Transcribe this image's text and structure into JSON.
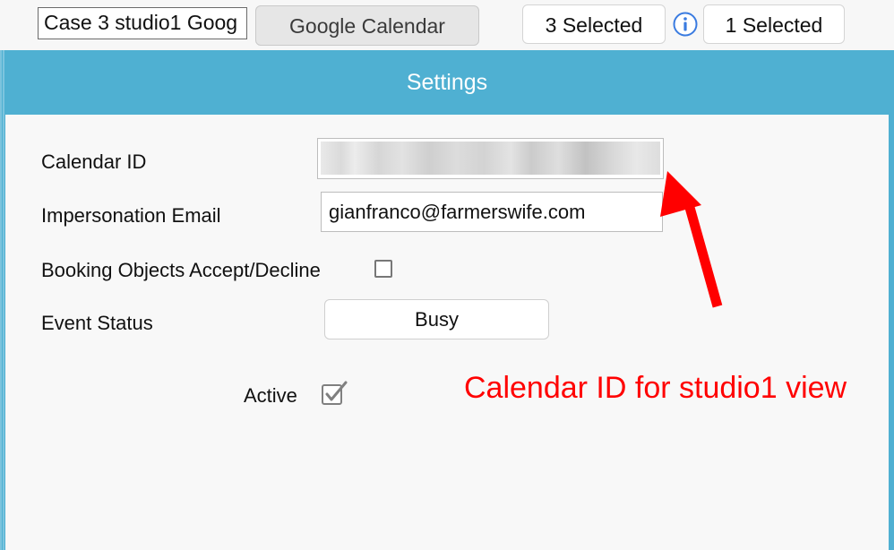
{
  "toolbar": {
    "name_value": "Case 3 studio1 Goog",
    "type_button_label": "Google Calendar",
    "selected_left": "3 Selected",
    "selected_right": "1 Selected",
    "info_icon": "info-circle-icon"
  },
  "panel": {
    "title": "Settings",
    "fields": {
      "calendar_id_label": "Calendar ID",
      "calendar_id_value": "",
      "impersonation_label": "Impersonation Email",
      "impersonation_value": "gianfranco@farmerswife.com",
      "booking_label": "Booking Objects Accept/Decline",
      "booking_checked": false,
      "event_status_label": "Event Status",
      "event_status_value": "Busy",
      "active_label": "Active",
      "active_checked": true
    }
  },
  "annotation": {
    "text": "Calendar ID for studio1 view",
    "color": "#ff0000"
  },
  "colors": {
    "panel_header": "#4fb0d2",
    "annotation_red": "#ff0000"
  }
}
